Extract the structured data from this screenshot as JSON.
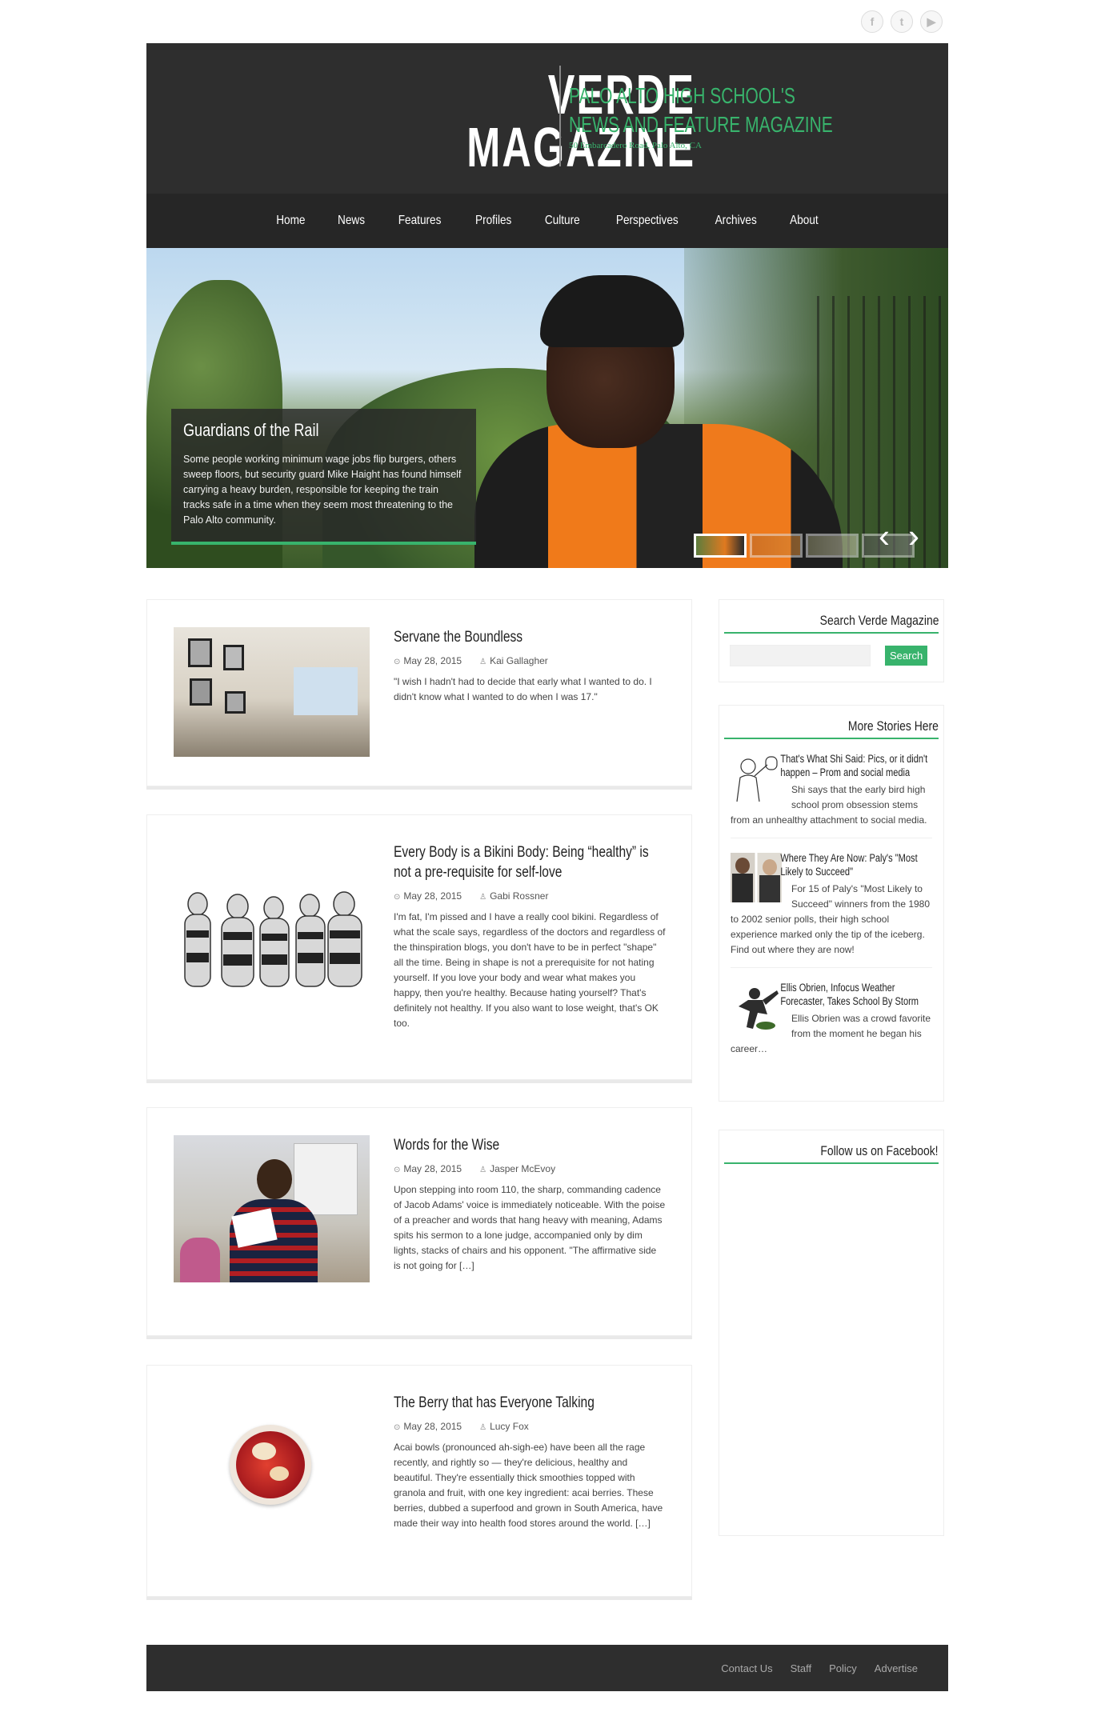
{
  "social": {
    "facebook": "f",
    "twitter": "t",
    "youtube": "▶"
  },
  "header": {
    "logo_line1": "VERDE",
    "logo_line2": "MAGAZINE",
    "tagline_line1": "PALO ALTO HIGH SCHOOL'S",
    "tagline_line2": "NEWS AND FEATURE MAGAZINE",
    "address": "50 Embarcadero Road, Palo Alto, CA"
  },
  "nav": {
    "items": [
      "Home",
      "News",
      "Features",
      "Profiles",
      "Culture",
      "Perspectives",
      "Archives",
      "About"
    ]
  },
  "slider": {
    "title": "Guardians of the Rail",
    "text": "Some people working minimum wage jobs flip burgers, others sweep floors, but security guard Mike Haight has found himself carrying a heavy burden, responsible for keeping the train tracks safe in a time when they seem most threatening to the Palo Alto community.",
    "prev": "‹",
    "next": "›"
  },
  "posts": [
    {
      "title": "Servane the Boundless",
      "date": "May 28, 2015",
      "author": "Kai Gallagher",
      "excerpt": "\"I wish I hadn't had to decide that early what I wanted to do. I didn't know what I wanted to do when I was 17.\""
    },
    {
      "title": "Every Body is a Bikini Body: Being “healthy” is not a pre-requisite for self-love",
      "date": "May 28, 2015",
      "author": "Gabi Rossner",
      "excerpt": "I'm fat, I'm pissed and I have a really cool bikini. Regardless of what the scale says, regardless of the doctors and regardless of the thinspiration blogs, you don't have to be in perfect \"shape\" all the time. Being in shape is not a prerequisite for not hating yourself. If you love your body and wear what makes you happy, then you're healthy. Because hating yourself? That's definitely not healthy. If you also want to lose weight, that's OK too."
    },
    {
      "title": "Words for the Wise",
      "date": "May 28, 2015",
      "author": "Jasper McEvoy",
      "excerpt": "  Upon stepping into room 110, the sharp, commanding cadence of Jacob Adams' voice is immediately noticeable. With the poise of a preacher and words that hang heavy with meaning, Adams spits his sermon to a lone judge, accompanied only by dim lights, stacks of chairs and his opponent. \"The affirmative side is not going for […]"
    },
    {
      "title": "The Berry that has Everyone Talking",
      "date": "May 28, 2015",
      "author": "Lucy Fox",
      "excerpt": "Acai bowls (pronounced ah-sigh-ee) have been all the rage recently, and rightly so — they're delicious, healthy and beautiful. They're essentially thick smoothies topped with granola and fruit, with one key ingredient: acai berries. These berries, dubbed a superfood and grown in South America, have made their way into health food stores around the world. […]"
    }
  ],
  "sidebar": {
    "search_title": "Search Verde Magazine",
    "search_button": "Search",
    "more_title": "More Stories Here",
    "stories": [
      {
        "title": "That's What Shi Said: Pics, or it didn't happen – Prom and social media",
        "text": "Shi says that the early bird high school prom obsession stems from an unhealthy attachment to social media."
      },
      {
        "title": "Where They Are Now: Paly's \"Most Likely to Succeed\"",
        "text": "For 15 of Paly's \"Most Likely to Succeed\" winners from the 1980 to 2002 senior polls, their high school experience marked only the tip of the iceberg. Find out where they are now!"
      },
      {
        "title": "Ellis Obrien, Infocus Weather Forecaster, Takes School By Storm",
        "text": "Ellis Obrien was a crowd favorite from the moment he began his career…"
      }
    ],
    "facebook_title": "Follow us on Facebook!"
  },
  "footer": {
    "links": [
      "Contact Us",
      "Staff",
      "Policy",
      "Advertise"
    ]
  },
  "colors": {
    "accent": "#38b36c",
    "header_bg": "#2e2e2e",
    "nav_bg": "#262626"
  }
}
